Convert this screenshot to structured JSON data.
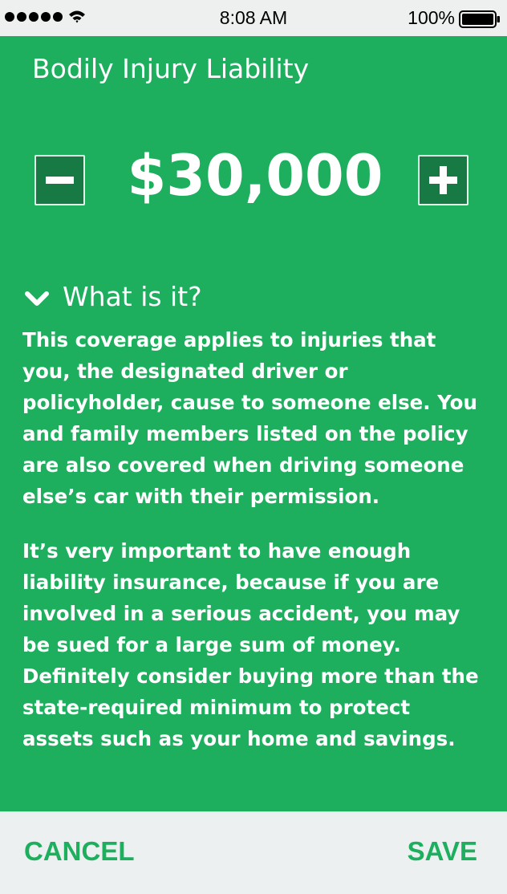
{
  "status_bar": {
    "time": "8:08 AM",
    "battery_percent": "100%",
    "signal_icon": "signal-dots-icon",
    "wifi_icon": "wifi-icon",
    "battery_icon": "battery-full-icon"
  },
  "coverage": {
    "title": "Bodily Injury Liability",
    "amount": "$30,000",
    "decrement_icon": "minus-icon",
    "increment_icon": "plus-icon"
  },
  "info": {
    "toggle_label": "What is it?",
    "toggle_icon": "chevron-down-icon",
    "paragraphs": [
      "This coverage applies to injuries that you, the designated driver or policyholder, cause to someone else. You and family members listed on the policy are also covered when driving someone else’s car with their permission.",
      "It’s very important to have enough liability insurance, because if you are involved in a serious accident, you may be sued for a large sum of money. Definitely consider buying more than the state-required minimum to protect assets such as your home and savings."
    ]
  },
  "footer": {
    "cancel_label": "CANCEL",
    "save_label": "SAVE"
  },
  "colors": {
    "accent_green": "#1daf5e",
    "dark_green": "#177a45",
    "footer_bg": "#ecf0f0"
  }
}
